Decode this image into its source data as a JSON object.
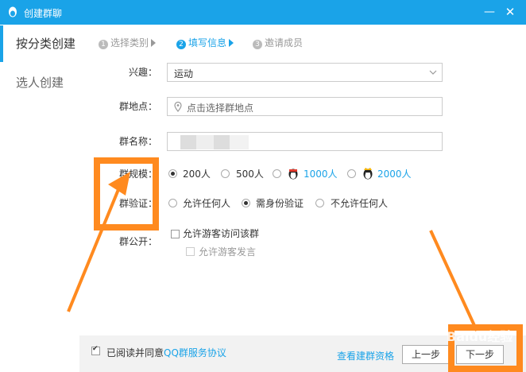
{
  "window": {
    "title": "创建群聊",
    "minimize_glyph": "—",
    "close_glyph": "✕"
  },
  "sidebar": {
    "items": [
      {
        "label": "按分类创建"
      },
      {
        "label": "选人创建"
      }
    ]
  },
  "steps": [
    {
      "num": "1",
      "label": "选择类别"
    },
    {
      "num": "2",
      "label": "填写信息"
    },
    {
      "num": "3",
      "label": "邀请成员"
    }
  ],
  "form": {
    "interest": {
      "label": "兴趣：",
      "value": "运动"
    },
    "location": {
      "label": "群地点：",
      "placeholder": "点击选择群地点"
    },
    "name": {
      "label": "群名称："
    },
    "size": {
      "label": "群规模：",
      "options": [
        "200人",
        "500人",
        "1000人",
        "2000人"
      ],
      "selected": "200人"
    },
    "verify": {
      "label": "群验证：",
      "options": [
        "允许任何人",
        "需身份验证",
        "不允许任何人"
      ],
      "selected": "需身份验证"
    },
    "public": {
      "label": "群公开：",
      "options": [
        "允许游客访问该群",
        "允许游客发言"
      ]
    }
  },
  "footer": {
    "agree_prefix": "已阅读并同意",
    "agree_link": "QQ群服务协议",
    "qualification_link": "查看建群资格",
    "prev_button": "上一步",
    "next_button": "下一步"
  },
  "watermark": "Baidu经验",
  "colors": {
    "accent": "#1aa3e8",
    "annotation": "#ff8a1f"
  },
  "icons": [
    "qq-penguin-icon",
    "minimize-icon",
    "close-icon",
    "chevron-down-icon",
    "location-pin-icon",
    "gold-penguin-icon",
    "arrow-annotation"
  ]
}
